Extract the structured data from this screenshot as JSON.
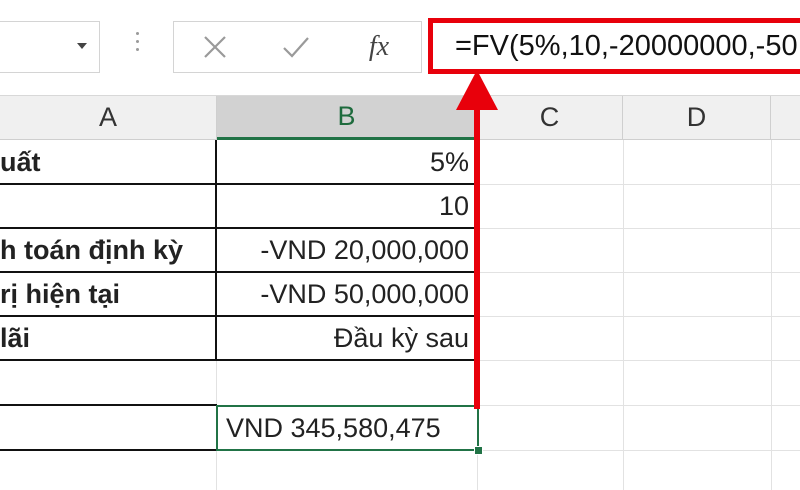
{
  "formula_bar": {
    "formula_text": "=FV(5%,10,-20000000,-50",
    "fx_label": "fx",
    "cancel_glyph": "✕",
    "enter_glyph": "✓"
  },
  "columns": [
    "A",
    "B",
    "C",
    "D"
  ],
  "rows": [
    {
      "a": "uất",
      "b": "5%"
    },
    {
      "a": "",
      "b": "10"
    },
    {
      "a": "h toán định kỳ",
      "b": "-VND 20,000,000"
    },
    {
      "a": "rị hiện tại",
      "b": "-VND 50,000,000"
    },
    {
      "a": "lãi",
      "b": "Đầu kỳ sau"
    },
    {
      "a": "",
      "b": ""
    },
    {
      "a": "",
      "b": "VND 345,580,475"
    }
  ],
  "colors": {
    "highlight_red": "#e8000b",
    "excel_green": "#217346"
  }
}
